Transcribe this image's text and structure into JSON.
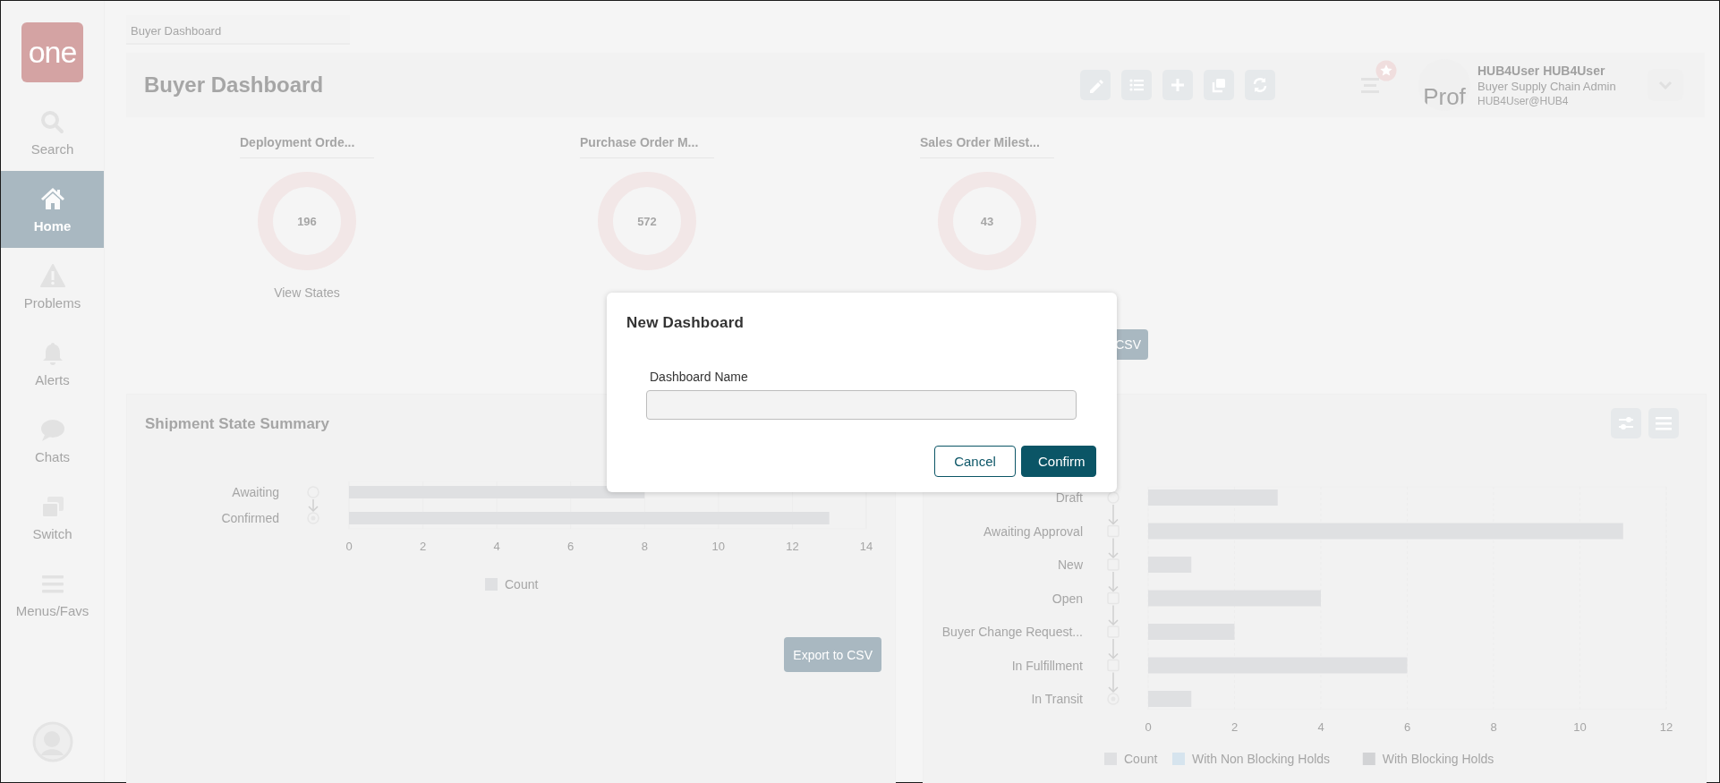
{
  "sidebar": {
    "logo": "one",
    "items": [
      {
        "kind": "search",
        "label": "Search",
        "selected": false
      },
      {
        "kind": "home",
        "label": "Home",
        "selected": true
      },
      {
        "kind": "problems",
        "label": "Problems",
        "selected": false
      },
      {
        "kind": "alerts",
        "label": "Alerts",
        "selected": false
      },
      {
        "kind": "chats",
        "label": "Chats",
        "selected": false
      },
      {
        "kind": "switch",
        "label": "Switch",
        "selected": false
      },
      {
        "kind": "menus",
        "label": "Menus/Favs",
        "selected": false
      }
    ]
  },
  "breadcrumb_tab": {
    "label": "Buyer Dashboard"
  },
  "header": {
    "title": "Buyer Dashboard",
    "toolbar": [
      {
        "kind": "edit"
      },
      {
        "kind": "list"
      },
      {
        "kind": "add"
      },
      {
        "kind": "copy"
      },
      {
        "kind": "refresh"
      }
    ],
    "user": {
      "avatar_text": "Prof",
      "name": "HUB4User HUB4User",
      "role": "Buyer Supply Chain Admin",
      "email": "HUB4User@HUB4"
    }
  },
  "tiles": [
    {
      "title": "Deployment Orde...",
      "value": "196",
      "link": "View States"
    },
    {
      "title": "Purchase Order M...",
      "value": "572"
    },
    {
      "title": "Sales Order Milest...",
      "value": "43"
    }
  ],
  "tiles_export_button": "CSV",
  "cards": [
    {
      "title": "Shipment State Summary",
      "export_button": "Export to CSV",
      "chart_data": {
        "type": "bar",
        "orientation": "horizontal",
        "categories": [
          "Awaiting",
          "Confirmed"
        ],
        "series": [
          {
            "name": "Count",
            "color": "#dfe0e2",
            "values": [
              8,
              13
            ]
          }
        ],
        "xlim": [
          0,
          14
        ],
        "xticks": [
          0,
          2,
          4,
          6,
          8,
          10,
          12,
          14
        ]
      }
    },
    {
      "chart_data": {
        "type": "bar",
        "orientation": "horizontal",
        "categories": [
          "Draft",
          "Awaiting Approval",
          "New",
          "Open",
          "Buyer Change Request...",
          "In Fulfillment",
          "In Transit"
        ],
        "series": [
          {
            "name": "Count",
            "color": "#dfe0e2",
            "values": [
              3,
              11,
              1,
              4,
              2,
              6,
              1
            ]
          },
          {
            "name": "With Non Blocking Holds",
            "color": "#d6e4ee",
            "values": [
              null,
              null,
              null,
              null,
              null,
              null,
              null
            ]
          },
          {
            "name": "With Blocking Holds",
            "color": "#d2d3d5",
            "values": [
              null,
              null,
              null,
              null,
              null,
              null,
              null
            ]
          }
        ],
        "xlim": [
          0,
          12
        ],
        "xticks": [
          0,
          2,
          4,
          6,
          8,
          10,
          12
        ]
      }
    }
  ],
  "dialog": {
    "title": "New Dashboard",
    "field_label": "Dashboard Name",
    "buttons": [
      {
        "kind": "secondary",
        "label": "Cancel"
      },
      {
        "kind": "primary",
        "label": "Confirm"
      }
    ]
  }
}
